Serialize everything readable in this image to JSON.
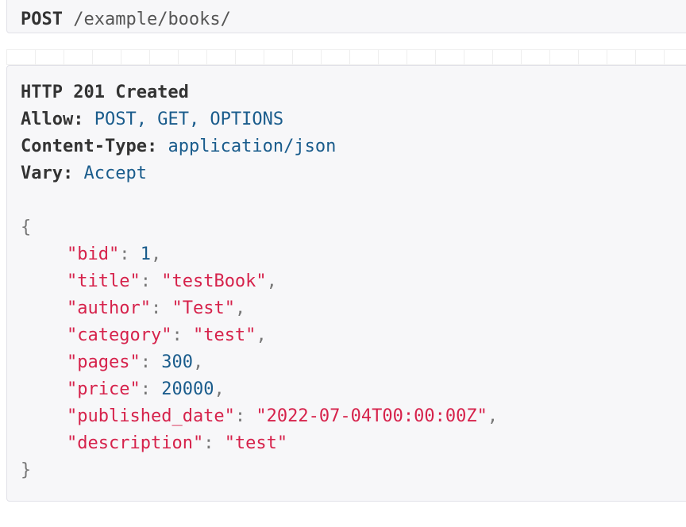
{
  "request": {
    "method": "POST",
    "path": "/example/books/"
  },
  "response": {
    "status": "HTTP 201 Created",
    "headers": [
      {
        "name": "Allow",
        "value": "POST, GET, OPTIONS"
      },
      {
        "name": "Content-Type",
        "value": "application/json"
      },
      {
        "name": "Vary",
        "value": "Accept"
      }
    ],
    "body": {
      "open_brace": "{",
      "close_brace": "}",
      "fields": [
        {
          "key": "\"bid\"",
          "value": "1",
          "type": "number",
          "trail": ","
        },
        {
          "key": "\"title\"",
          "value": "\"testBook\"",
          "type": "string",
          "trail": ","
        },
        {
          "key": "\"author\"",
          "value": "\"Test\"",
          "type": "string",
          "trail": ","
        },
        {
          "key": "\"category\"",
          "value": "\"test\"",
          "type": "string",
          "trail": ","
        },
        {
          "key": "\"pages\"",
          "value": "300",
          "type": "number",
          "trail": ","
        },
        {
          "key": "\"price\"",
          "value": "20000",
          "type": "number",
          "trail": ","
        },
        {
          "key": "\"published_date\"",
          "value": "\"2022-07-04T00:00:00Z\"",
          "type": "string",
          "trail": ","
        },
        {
          "key": "\"description\"",
          "value": "\"test\"",
          "type": "string",
          "trail": ""
        }
      ]
    }
  },
  "colors": {
    "panel_bg": "#f7f7f9",
    "key": "#d6224b",
    "header_value": "#1a5c8c"
  }
}
